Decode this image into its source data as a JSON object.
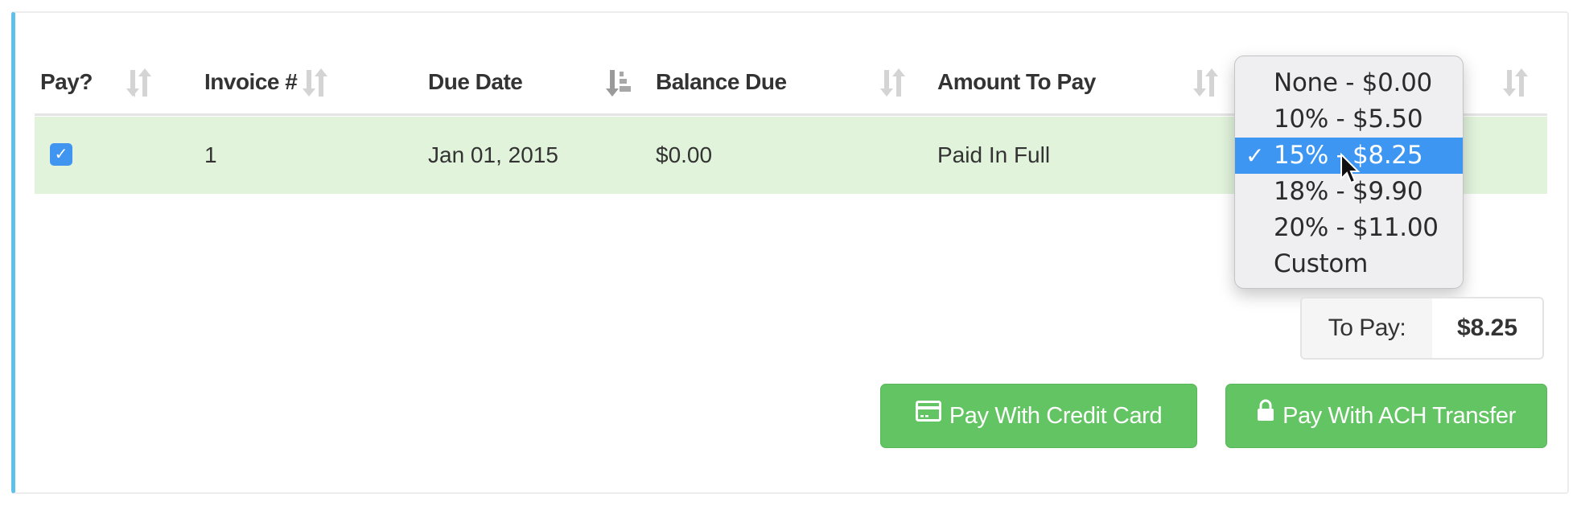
{
  "table": {
    "columns": [
      {
        "label": "Pay?",
        "sort": "unsorted"
      },
      {
        "label": "Invoice #",
        "sort": "unsorted"
      },
      {
        "label": "Due Date",
        "sort": "descending"
      },
      {
        "label": "Balance Due",
        "sort": "unsorted"
      },
      {
        "label": "Amount To Pay",
        "sort": "unsorted"
      },
      {
        "label": "",
        "sort": "unsorted"
      }
    ],
    "rows": [
      {
        "pay_checked": true,
        "invoice": "1",
        "due_date": "Jan 01, 2015",
        "balance_due": "$0.00",
        "amount_to_pay": "Paid In Full"
      }
    ]
  },
  "tip_dropdown": {
    "selected": "15% - $8.25",
    "options": [
      {
        "label": "None - $0.00",
        "selected": false
      },
      {
        "label": "10% - $5.50",
        "selected": false
      },
      {
        "label": "15% - $8.25",
        "selected": true
      },
      {
        "label": "18% - $9.90",
        "selected": false
      },
      {
        "label": "20% - $11.00",
        "selected": false
      },
      {
        "label": "Custom",
        "selected": false
      }
    ],
    "check_glyph": "✓"
  },
  "summary": {
    "to_pay_label": "To Pay:",
    "to_pay_value": "$8.25"
  },
  "actions": {
    "credit_card_label": "Pay With Credit Card",
    "credit_card_icon": "credit-card-icon",
    "ach_label": "Pay With ACH Transfer",
    "ach_icon": "lock-icon"
  },
  "colors": {
    "accent_border": "#5fc0e8",
    "selected_row": "#e1f3db",
    "button_green": "#62c462",
    "dropdown_highlight": "#3e96f3",
    "checkbox_blue": "#3f95f0"
  }
}
